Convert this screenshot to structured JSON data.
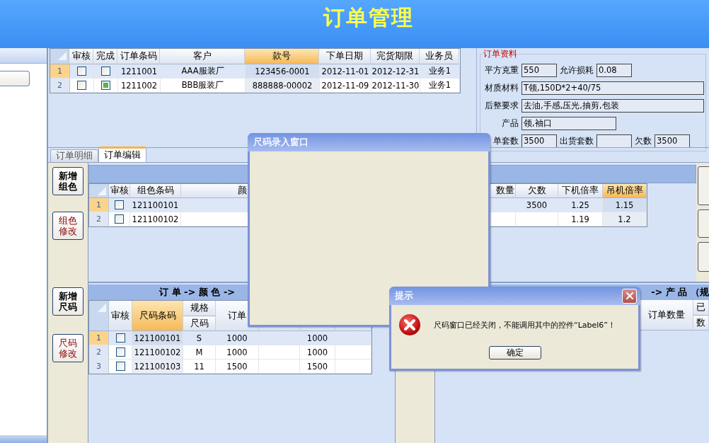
{
  "header": {
    "title": "订单管理"
  },
  "orders": {
    "columns": [
      {
        "label": "审核",
        "kind": "check",
        "highlighted": false
      },
      {
        "label": "完成",
        "kind": "check",
        "highlighted": false
      },
      {
        "label": "订单条码",
        "kind": "text",
        "highlighted": false
      },
      {
        "label": "客户",
        "kind": "text",
        "highlighted": false
      },
      {
        "label": "款号",
        "kind": "text",
        "highlighted": true
      },
      {
        "label": "下单日期",
        "kind": "text",
        "highlighted": false
      },
      {
        "label": "完货期限",
        "kind": "text",
        "highlighted": false
      },
      {
        "label": "业务员",
        "kind": "text",
        "highlighted": false
      }
    ],
    "rows": [
      {
        "index": "1",
        "selected": true,
        "cells": [
          false,
          false,
          "1211001",
          "AAA服装厂",
          "123456-0001",
          "2012-11-01",
          "2012-12-31",
          "业务1"
        ]
      },
      {
        "index": "2",
        "selected": false,
        "cells": [
          false,
          true,
          "1211002",
          "BBB服装厂",
          "888888-00002",
          "2012-11-09",
          "2012-11-30",
          "业务1"
        ]
      }
    ]
  },
  "order_info": {
    "title": "订单资料",
    "rows": [
      [
        {
          "label": "平方克重",
          "value": "550",
          "kind": "short"
        },
        {
          "label": "允许损耗",
          "value": "0.08",
          "kind": "short"
        }
      ],
      [
        {
          "label": "材质材料",
          "value": "T领,150D*2+40/75",
          "kind": "long"
        }
      ],
      [
        {
          "label": "后整要求",
          "value": "去油,手感,压光,抽剪,包装",
          "kind": "long"
        }
      ],
      [
        {
          "label": "产品",
          "value": "领,袖口",
          "kind": "medium"
        }
      ],
      [
        {
          "label": "单套数",
          "value": "3500",
          "kind": "short"
        },
        {
          "label": "出货套数",
          "kind": "short"
        },
        {
          "label": "欠数",
          "value": "3500",
          "kind": "short"
        }
      ]
    ]
  },
  "tabs": [
    {
      "label": "订单明细",
      "selected": false
    },
    {
      "label": "订单编辑",
      "selected": true
    }
  ],
  "side_buttons": [
    {
      "label": "新增组色",
      "kind": "add"
    },
    {
      "label": "组色修改",
      "kind": "edit"
    },
    {
      "label": "新增尺码",
      "kind": "add"
    },
    {
      "label": "尺码修改",
      "kind": "edit"
    }
  ],
  "color_grid": {
    "columns": [
      {
        "label": "审核",
        "kind": "check",
        "highlighted": false
      },
      {
        "label": "组色条码",
        "kind": "text",
        "highlighted": false
      },
      {
        "label": "颜",
        "kind": "text",
        "highlighted": false
      },
      {
        "label": "数量",
        "kind": "text",
        "highlighted": false
      },
      {
        "label": "欠数",
        "kind": "text",
        "highlighted": false
      },
      {
        "label": "下机倍率",
        "kind": "text",
        "highlighted": false
      },
      {
        "label": "吊机倍率",
        "kind": "text",
        "highlighted": true
      }
    ],
    "rows": [
      {
        "index": "1",
        "selected": true,
        "cells": [
          false,
          "121100101",
          null,
          null,
          "3500",
          "1.25",
          "1.15"
        ]
      },
      {
        "index": "2",
        "selected": false,
        "cells": [
          false,
          "121100102",
          null,
          null,
          null,
          "1.19",
          "1.2"
        ]
      }
    ]
  },
  "size_grid": {
    "banner_left": "订 单 -> 颜 色 ->",
    "banner_right": "-> 产 品 （规",
    "columns": [
      {
        "label": "审核",
        "kind": "check",
        "highlighted": false
      },
      {
        "label": "尺码条码",
        "kind": "text",
        "highlighted": true
      },
      {
        "label": "规格",
        "sublabel": "尺码",
        "kind": "text",
        "highlighted": false
      },
      {
        "label": "订单",
        "kind": "text",
        "highlighted": false
      },
      {
        "kind": "text",
        "highlighted": false
      },
      {
        "kind": "text",
        "highlighted": false
      },
      {
        "kind": "text",
        "highlighted": false
      }
    ],
    "rows": [
      {
        "index": "1",
        "selected": true,
        "cells": [
          false,
          "121100101",
          "S",
          "1000",
          null,
          "1000",
          null
        ]
      },
      {
        "index": "2",
        "selected": false,
        "cells": [
          false,
          "121100102",
          "M",
          "1000",
          null,
          "1000",
          null
        ]
      },
      {
        "index": "3",
        "selected": false,
        "cells": [
          false,
          "121100103",
          "11",
          "1500",
          null,
          "1500",
          null
        ]
      }
    ]
  },
  "product_grid": {
    "columns": [
      {
        "label": "订单数量"
      },
      {
        "label": "已",
        "sublabel": "数"
      }
    ]
  },
  "size_dialog": {
    "title": "尺码录入窗口"
  },
  "alert": {
    "title": "提示",
    "message": "尺码窗口已经关闭，不能调用其中的控件“Label6”！",
    "button": "确定"
  }
}
